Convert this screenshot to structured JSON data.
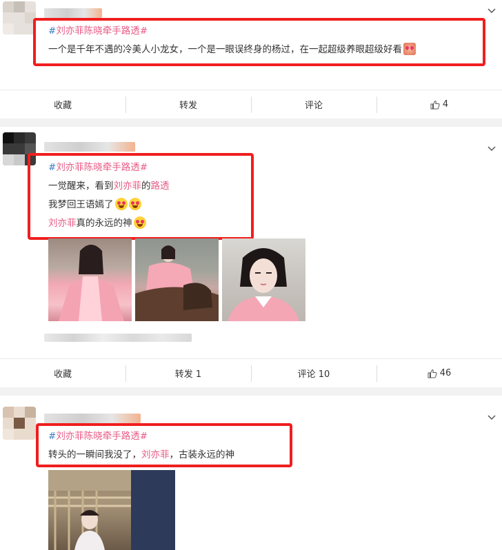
{
  "posts": [
    {
      "hashtag": "#刘亦菲陈晓牵手路透#",
      "lines": [
        "一个是千年不遇的冷美人小龙女，一个是一眼误终身的杨过，在一起超级养眼超级好看"
      ],
      "actions": {
        "favorite": "收藏",
        "repost": "转发",
        "comment": "评论",
        "likes": "4"
      }
    },
    {
      "hashtag": "#刘亦菲陈晓牵手路透#",
      "line1_a": "一觉醒来，看到",
      "line1_topic": "刘亦菲",
      "line1_b": "的",
      "line1_topic2": "路透",
      "line2": "我梦回王语嫣了",
      "line3_topic": "刘亦菲",
      "line3_rest": "真的永远的神",
      "actions": {
        "favorite": "收藏",
        "repost": "转发 1",
        "comment": "评论 10",
        "likes": "46"
      },
      "photos": [
        "pink-costume-outdoor",
        "pink-costume-horse",
        "pink-costume-closeup"
      ]
    },
    {
      "hashtag": "#刘亦菲陈晓牵手路透#",
      "line1_a": "转头的一瞬间我没了，",
      "line1_topic": "刘亦菲",
      "line1_b": "，古装永远的神",
      "photos": [
        "set-behind-scenes"
      ]
    }
  ],
  "icons": {
    "collapse": "chevron-down-icon",
    "like": "thumbs-up-icon",
    "emoji": "heart-eyes-emoji"
  },
  "colors": {
    "topic": "#e75b85",
    "hash": "#3b7fc4",
    "highlight_box": "#f01e1e"
  }
}
